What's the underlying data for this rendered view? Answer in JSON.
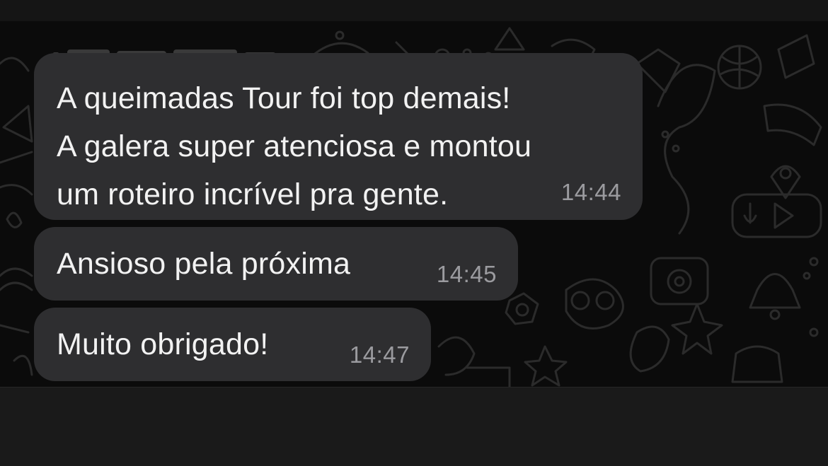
{
  "messages": [
    {
      "text": "A queimadas Tour foi top demais!\nA galera super atenciosa e montou\num roteiro incrível pra gente.",
      "time": "14:44"
    },
    {
      "text": "Ansioso pela próxima",
      "time": "14:45"
    },
    {
      "text": "Muito obrigado!",
      "time": "14:47"
    }
  ],
  "colors": {
    "bubble": "#2e2e30",
    "text": "#f2f2f2",
    "timestamp": "#9b9b9f",
    "wallpaper": "#0b0b0b",
    "doodle": "#2b2b2b"
  }
}
